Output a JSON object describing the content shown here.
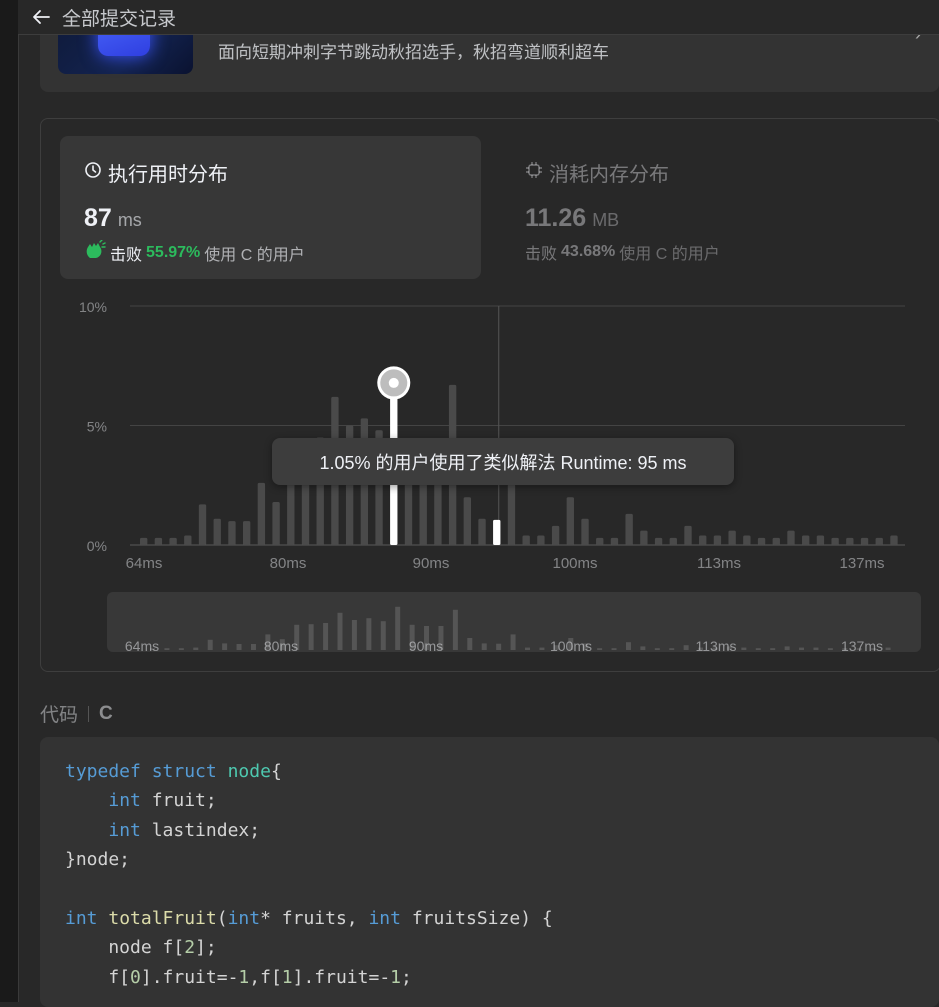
{
  "header": {
    "title": "全部提交记录",
    "back_icon": "arrow-left-icon"
  },
  "banner": {
    "description": "面向短期冲刺字节跳动秋招选手，秋招弯道顺利超车"
  },
  "stats": {
    "runtime": {
      "label": "执行用时分布",
      "value": "87",
      "unit": "ms",
      "beat_prefix": "击败",
      "beat_pct": "55.97%",
      "beat_suffix": "使用 C 的用户",
      "icon": "clock-icon"
    },
    "memory": {
      "label": "消耗内存分布",
      "value": "11.26",
      "unit": "MB",
      "beat_prefix": "击败",
      "beat_pct": "43.68%",
      "beat_suffix": "使用 C 的用户",
      "icon": "chip-icon"
    }
  },
  "tooltip": "1.05% 的用户使用了类似解法 Runtime: 95 ms",
  "chart_data": {
    "type": "bar",
    "ylim": [
      0,
      10
    ],
    "y_ticks": [
      "10%",
      "5%",
      "0%"
    ],
    "x_ticks": [
      "64ms",
      "80ms",
      "90ms",
      "100ms",
      "113ms",
      "137ms"
    ],
    "values": [
      0.3,
      0.3,
      0.3,
      0.4,
      1.7,
      1.1,
      1.0,
      1.0,
      2.6,
      1.8,
      4.2,
      4.3,
      4.5,
      6.2,
      5.0,
      5.3,
      4.8,
      7.2,
      4.2,
      4.0,
      4.0,
      6.7,
      2.0,
      1.1,
      1.05,
      2.6,
      0.4,
      0.4,
      0.8,
      2.0,
      1.1,
      0.3,
      0.3,
      1.3,
      0.6,
      0.3,
      0.3,
      0.8,
      0.4,
      0.4,
      0.6,
      0.4,
      0.3,
      0.3,
      0.6,
      0.4,
      0.4,
      0.3,
      0.3,
      0.3,
      0.3,
      0.4
    ],
    "highlight_current": "87ms",
    "highlight_hover": "95ms",
    "grid": true
  },
  "code": {
    "label": "代码",
    "lang": "C"
  }
}
